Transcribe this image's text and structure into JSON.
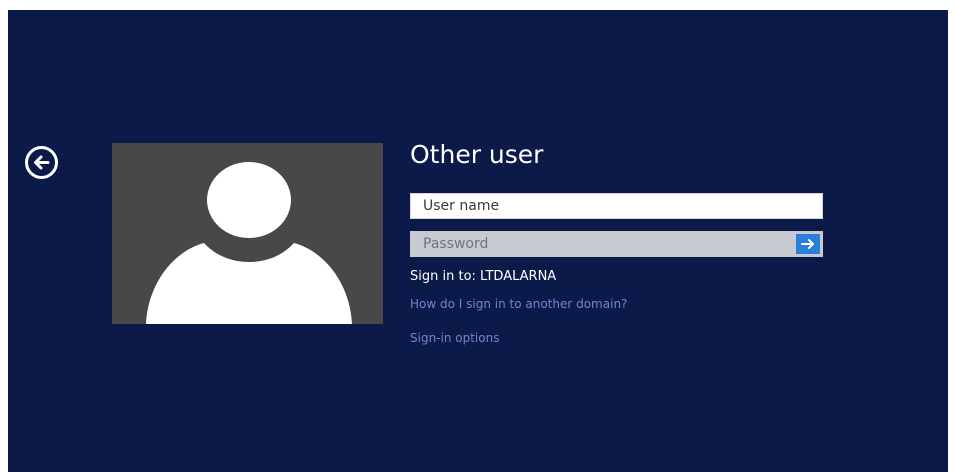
{
  "login": {
    "title": "Other user",
    "username_placeholder": "User name",
    "password_placeholder": "Password",
    "sign_in_to": "Sign in to: LTDALARNA",
    "domain_help_link": "How do I sign in to another domain?",
    "signin_options_link": "Sign-in options"
  },
  "colors": {
    "background": "#0c1a4a",
    "avatar_tile": "#484848",
    "submit_accent": "#2a7fd8",
    "link": "#6f86c9"
  },
  "icons": {
    "back": "back-arrow-circle-icon",
    "avatar": "user-silhouette-icon",
    "submit": "right-arrow-icon"
  }
}
